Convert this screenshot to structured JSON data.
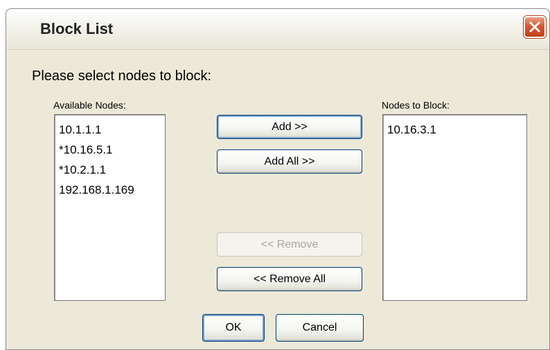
{
  "window": {
    "title": "Block List"
  },
  "prompt": "Please select nodes to block:",
  "available": {
    "label": "Available Nodes:",
    "items": [
      "10.1.1.1",
      "*10.16.5.1",
      "*10.2.1.1",
      "192.168.1.169"
    ]
  },
  "blocked": {
    "label": "Nodes to Block:",
    "items": [
      "10.16.3.1"
    ]
  },
  "buttons": {
    "add": "Add >>",
    "add_all": "Add All >>",
    "remove": "<< Remove",
    "remove_all": "<< Remove All",
    "ok": "OK",
    "cancel": "Cancel"
  },
  "states": {
    "remove_enabled": false
  },
  "icons": {
    "close": "close-icon"
  },
  "colors": {
    "close_button": "#d55a35",
    "focus_ring": "#7da2ce"
  }
}
